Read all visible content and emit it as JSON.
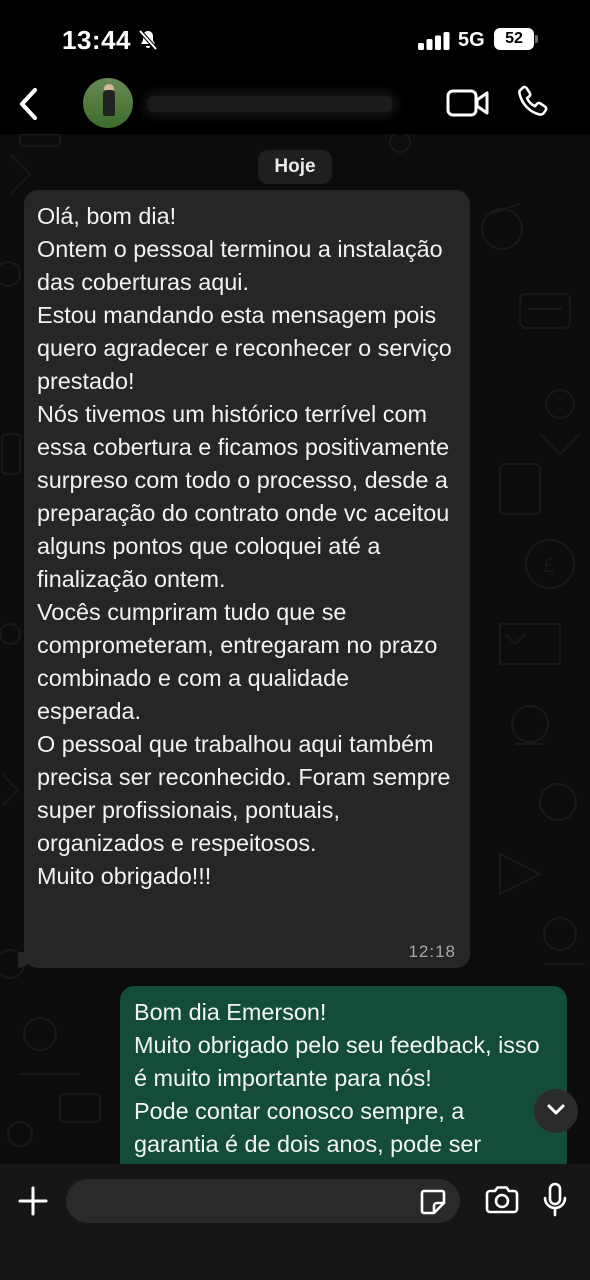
{
  "status_bar": {
    "time": "13:44",
    "network": "5G",
    "battery": "52",
    "icons": [
      "bell-slash-icon",
      "signal-icon"
    ]
  },
  "header": {
    "icons": [
      "back-chevron-icon",
      "video-call-icon",
      "phone-icon"
    ]
  },
  "chat": {
    "date_label": "Hoje",
    "messages": [
      {
        "direction": "incoming",
        "text": "Olá, bom dia!\nOntem o pessoal terminou a instalação das coberturas aqui.\nEstou mandando esta mensagem pois quero agradecer e reconhecer  o serviço prestado!\nNós tivemos um histórico terrível com essa cobertura e ficamos positivamente surpreso com todo o processo, desde a preparação do contrato onde vc aceitou alguns pontos que coloquei até a finalização ontem.\nVocês cumpriram tudo que se comprometeram, entregaram no prazo combinado e com a qualidade esperada.\nO pessoal que trabalhou aqui também precisa ser reconhecido. Foram sempre super profissionais, pontuais, organizados e respeitosos.\nMuito obrigado!!!",
        "time": "12:18"
      },
      {
        "direction": "outgoing",
        "text": "Bom dia Emerson!\nMuito obrigado pelo seu feedback, isso é muito importante para nós!\nPode contar conosco sempre, a garantia é de dois anos, pode ser"
      }
    ]
  },
  "composer": {
    "placeholder": "",
    "icons": [
      "plus-icon",
      "sticker-icon",
      "camera-icon",
      "microphone-icon"
    ]
  },
  "colors": {
    "incoming_bubble": "#262626",
    "outgoing_bubble": "#144d37",
    "background": "#0b0b0b"
  }
}
